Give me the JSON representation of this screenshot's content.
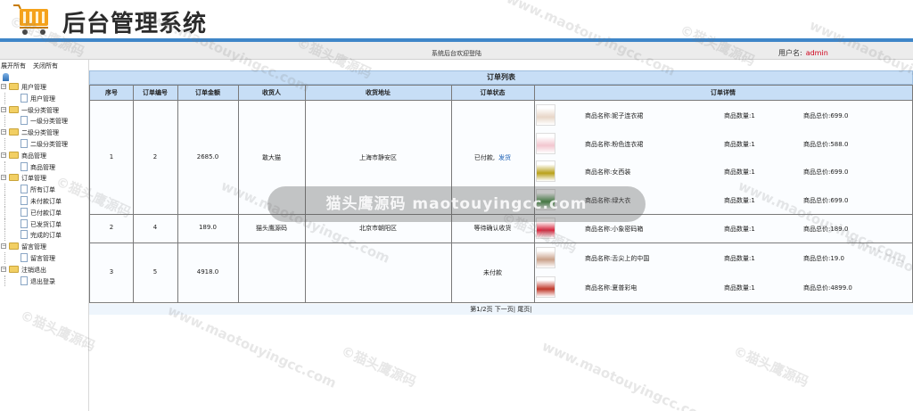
{
  "header": {
    "title": "后台管理系统",
    "welcome": "系统后台欢迎登陆",
    "user_label": "用户名:",
    "user_name": "admin",
    "cart_icon": "shopping-cart-icon"
  },
  "sidebar": {
    "expand_all": "展开所有",
    "collapse_all": "关闭所有",
    "tree": [
      {
        "label": "用户管理",
        "children": [
          "用户管理"
        ]
      },
      {
        "label": "一级分类管理",
        "children": [
          "一级分类管理"
        ]
      },
      {
        "label": "二级分类管理",
        "children": [
          "二级分类管理"
        ]
      },
      {
        "label": "商品管理",
        "children": [
          "商品管理"
        ]
      },
      {
        "label": "订单管理",
        "children": [
          "所有订单",
          "未付款订单",
          "已付款订单",
          "已发货订单",
          "完成的订单"
        ]
      },
      {
        "label": "留言管理",
        "children": [
          "留言管理"
        ]
      },
      {
        "label": "注销退出",
        "children": [
          "退出登录"
        ]
      }
    ]
  },
  "order_list": {
    "title": "订单列表",
    "columns": [
      "序号",
      "订单编号",
      "订单金额",
      "收货人",
      "收货地址",
      "订单状态",
      "订单详情"
    ],
    "rows": [
      {
        "index": "1",
        "order_no": "2",
        "amount": "2685.0",
        "receiver": "敢大猫",
        "address": "上海市静安区",
        "status": "已付款,",
        "action": "发货",
        "items": [
          {
            "name": "商品名称:妮子连衣裙",
            "qty": "商品数量:1",
            "total": "商品总价:699.0",
            "thumb_color": "#e8d6c8"
          },
          {
            "name": "商品名称:粉色连衣裙",
            "qty": "商品数量:1",
            "total": "商品总价:588.0",
            "thumb_color": "#f2c6cf"
          },
          {
            "name": "商品名称:女西装",
            "qty": "商品数量:1",
            "total": "商品总价:699.0",
            "thumb_color": "#b9a11a"
          },
          {
            "name": "商品名称:绿大衣",
            "qty": "商品数量:1",
            "total": "商品总价:699.0",
            "thumb_color": "#3c8a3a"
          }
        ]
      },
      {
        "index": "2",
        "order_no": "4",
        "amount": "189.0",
        "receiver": "猫头鹰源码",
        "address": "北京市朝阳区",
        "status": "等待确认收货",
        "action": "",
        "items": [
          {
            "name": "商品名称:小象密码箱",
            "qty": "商品数量:1",
            "total": "商品总价:189.0",
            "thumb_color": "#d7263d"
          }
        ]
      },
      {
        "index": "3",
        "order_no": "5",
        "amount": "4918.0",
        "receiver": "",
        "address": "",
        "status": "未付款",
        "action": "",
        "items": [
          {
            "name": "商品名称:舌尖上的中国",
            "qty": "商品数量:1",
            "total": "商品总价:19.0",
            "thumb_color": "#caa28a"
          },
          {
            "name": "商品名称:夏普彩电",
            "qty": "商品数量:1",
            "total": "商品总价:4899.0",
            "thumb_color": "#c0392b"
          }
        ]
      }
    ]
  },
  "pager": {
    "text": "第1/2页",
    "next": "下一页|",
    "last": "尾页|"
  },
  "watermark": {
    "text": "©猫头鹰源码",
    "url": "www.maotouyingcc.com",
    "center": "猫头鹰源码 maotouyingcc.com"
  }
}
